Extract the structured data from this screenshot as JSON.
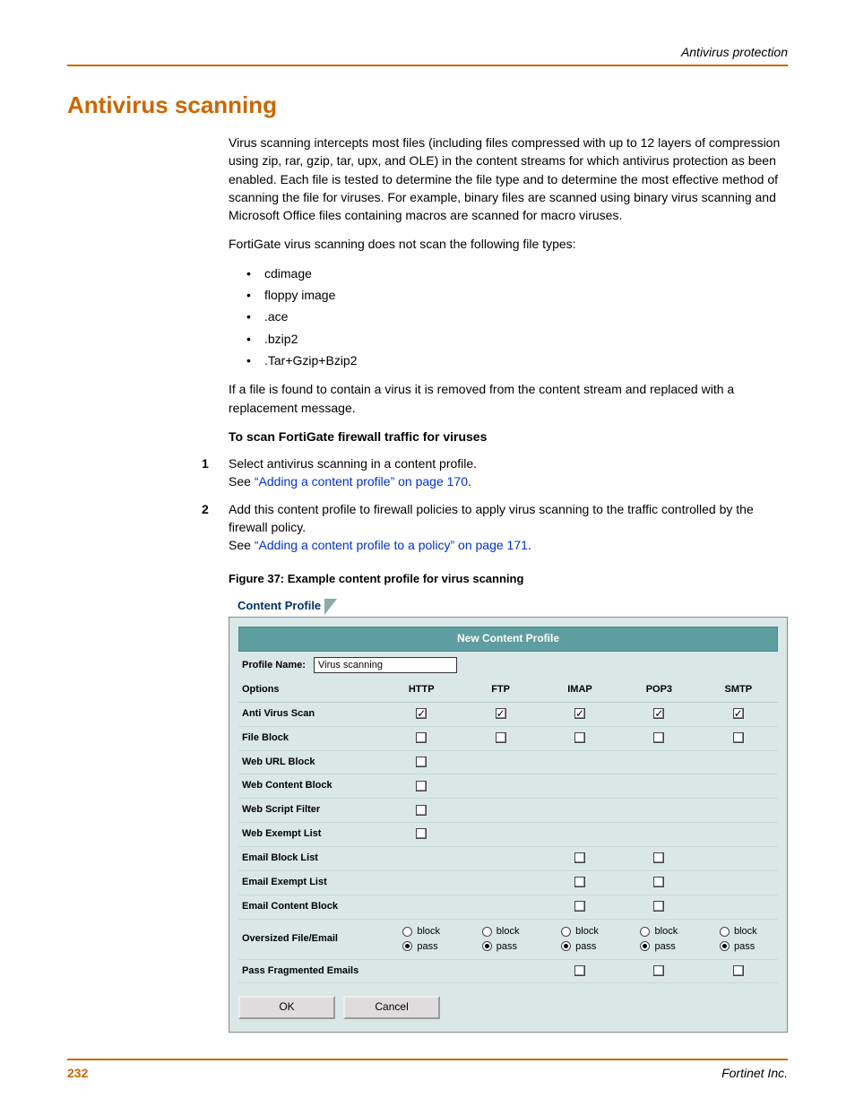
{
  "header": {
    "right": "Antivirus protection"
  },
  "title": "Antivirus scanning",
  "para1": "Virus scanning intercepts most files (including files compressed with up to 12 layers of compression using zip, rar, gzip, tar, upx, and OLE) in the content streams for which antivirus protection as been enabled. Each file is tested to determine the file type and to determine the most effective method of scanning the file for viruses. For example, binary files are scanned using binary virus scanning and Microsoft Office files containing macros are scanned for macro viruses.",
  "para2": "FortiGate virus scanning does not scan the following file types:",
  "bullets": [
    "cdimage",
    "floppy image",
    ".ace",
    ".bzip2",
    ".Tar+Gzip+Bzip2"
  ],
  "para3": "If a file is found to contain a virus it is removed from the content stream and replaced with a replacement message.",
  "procHead": "To scan FortiGate firewall traffic for viruses",
  "steps": [
    {
      "num": "1",
      "line1": "Select antivirus scanning in a content profile.",
      "see": "See ",
      "link": "“Adding a content profile” on page 170",
      "period": "."
    },
    {
      "num": "2",
      "line1": "Add this content profile to firewall policies to apply virus scanning to the traffic controlled by the firewall policy.",
      "see": "See ",
      "link": "“Adding a content profile to a policy” on page 171",
      "period": "."
    }
  ],
  "figCaption": "Figure 37: Example content profile for virus scanning",
  "panel": {
    "tabLabel": "Content Profile",
    "titleBar": "New Content Profile",
    "profileNameLabel": "Profile Name:",
    "profileNameValue": "Virus scanning",
    "columns": [
      "Options",
      "HTTP",
      "FTP",
      "IMAP",
      "POP3",
      "SMTP"
    ],
    "rows": [
      {
        "name": "Anti Virus Scan",
        "cells": [
          "chk",
          "chk",
          "chk",
          "chk",
          "chk"
        ],
        "checked": [
          true,
          true,
          true,
          true,
          true
        ]
      },
      {
        "name": "File Block",
        "cells": [
          "chk",
          "chk",
          "chk",
          "chk",
          "chk"
        ],
        "checked": [
          false,
          false,
          false,
          false,
          false
        ]
      },
      {
        "name": "Web URL Block",
        "cells": [
          "chk",
          "",
          "",
          "",
          ""
        ],
        "checked": [
          false
        ]
      },
      {
        "name": "Web Content Block",
        "cells": [
          "chk",
          "",
          "",
          "",
          ""
        ],
        "checked": [
          false
        ]
      },
      {
        "name": "Web Script Filter",
        "cells": [
          "chk",
          "",
          "",
          "",
          ""
        ],
        "checked": [
          false
        ]
      },
      {
        "name": "Web Exempt List",
        "cells": [
          "chk",
          "",
          "",
          "",
          ""
        ],
        "checked": [
          false
        ]
      },
      {
        "name": "Email Block List",
        "cells": [
          "",
          "",
          "chk",
          "chk",
          ""
        ],
        "checked": [
          null,
          null,
          false,
          false
        ]
      },
      {
        "name": "Email Exempt List",
        "cells": [
          "",
          "",
          "chk",
          "chk",
          ""
        ],
        "checked": [
          null,
          null,
          false,
          false
        ]
      },
      {
        "name": "Email Content Block",
        "cells": [
          "",
          "",
          "chk",
          "chk",
          ""
        ],
        "checked": [
          null,
          null,
          false,
          false
        ]
      },
      {
        "name": "Oversized File/Email",
        "cells": [
          "radio",
          "radio",
          "radio",
          "radio",
          "radio"
        ]
      },
      {
        "name": "Pass Fragmented Emails",
        "cells": [
          "",
          "",
          "chk",
          "chk",
          "chk"
        ],
        "checked": [
          null,
          null,
          false,
          false,
          false
        ]
      }
    ],
    "radioLabels": {
      "block": "block",
      "pass": "pass"
    },
    "buttons": {
      "ok": "OK",
      "cancel": "Cancel"
    }
  },
  "footer": {
    "page": "232",
    "company": "Fortinet Inc."
  }
}
